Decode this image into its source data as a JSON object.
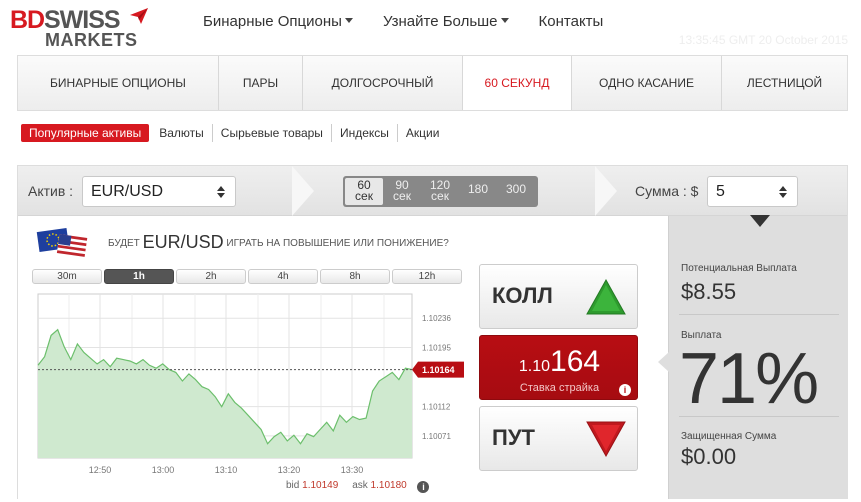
{
  "header": {
    "logo": {
      "bd": "BD",
      "swiss": "SWISS",
      "markets": "MARKETS"
    },
    "nav": [
      {
        "label": "Бинарные Опционы",
        "dropdown": true
      },
      {
        "label": "Узнайте Больше",
        "dropdown": true
      },
      {
        "label": "Контакты",
        "dropdown": false
      }
    ],
    "clock": "13:35:45 GMT 20 October 2015"
  },
  "tabs": [
    {
      "label": "БИНАРНЫЕ ОПЦИОНЫ",
      "active": false
    },
    {
      "label": "ПАРЫ",
      "active": false
    },
    {
      "label": "ДОЛГОСРОЧНЫЙ",
      "active": false
    },
    {
      "label": "60 СЕКУНД",
      "active": true
    },
    {
      "label": "ОДНО КАСАНИЕ",
      "active": false
    },
    {
      "label": "ЛЕСТНИЦОЙ",
      "active": false
    }
  ],
  "subnav": [
    {
      "label": "Популярные активы",
      "active": true
    },
    {
      "label": "Валюты",
      "active": false
    },
    {
      "label": "Сырьевые товары",
      "active": false
    },
    {
      "label": "Индексы",
      "active": false
    },
    {
      "label": "Акции",
      "active": false
    }
  ],
  "controls": {
    "asset_label": "Актив :",
    "asset_value": "EUR/USD",
    "expiry": [
      {
        "top": "60",
        "bottom": "сек",
        "active": true
      },
      {
        "top": "90",
        "bottom": "сек",
        "active": false
      },
      {
        "top": "120",
        "bottom": "сек",
        "active": false
      },
      {
        "top": "180",
        "bottom": "",
        "active": false
      },
      {
        "top": "300",
        "bottom": "",
        "active": false
      }
    ],
    "amount_label": "Сумма : $",
    "amount_value": "5"
  },
  "chart_header": {
    "prefix": "БУДЕТ",
    "pair": "EUR/USD",
    "suffix": "ИГРАТЬ НА ПОВЫШЕНИЕ ИЛИ ПОНИЖЕНИЕ?"
  },
  "ranges": [
    {
      "label": "30m",
      "active": false
    },
    {
      "label": "1h",
      "active": true
    },
    {
      "label": "2h",
      "active": false
    },
    {
      "label": "4h",
      "active": false
    },
    {
      "label": "8h",
      "active": false
    },
    {
      "label": "12h",
      "active": false
    }
  ],
  "chart_data": {
    "type": "area",
    "x_ticks": [
      "12:50",
      "13:00",
      "13:10",
      "13:20",
      "13:30"
    ],
    "y_ticks": [
      1.10236,
      1.10195,
      1.10112,
      1.10071
    ],
    "ylim": [
      1.1004,
      1.1027
    ],
    "current_price": "1.10164",
    "grid": true,
    "values": [
      1.1017,
      1.10182,
      1.10212,
      1.1022,
      1.10196,
      1.10178,
      1.102,
      1.10188,
      1.1018,
      1.10172,
      1.10178,
      1.10168,
      1.1018,
      1.10178,
      1.10176,
      1.10172,
      1.10178,
      1.1017,
      1.10166,
      1.10172,
      1.10164,
      1.1016,
      1.10148,
      1.10158,
      1.1015,
      1.1014,
      1.10136,
      1.10126,
      1.10112,
      1.1013,
      1.10118,
      1.1011,
      1.101,
      1.1009,
      1.1008,
      1.1006,
      1.1007,
      1.10076,
      1.10064,
      1.10072,
      1.1006,
      1.10074,
      1.1007,
      1.1008,
      1.1009,
      1.10078,
      1.101,
      1.1009,
      1.10098,
      1.10094,
      1.10096,
      1.10134,
      1.10148,
      1.10154,
      1.1016,
      1.1015,
      1.10166,
      1.10164
    ]
  },
  "quote": {
    "bid_label": "bid",
    "bid_value": "1.10149",
    "ask_label": "ask",
    "ask_value": "1.10180"
  },
  "buttons": {
    "call_label": "КОЛЛ",
    "put_label": "ПУТ",
    "strike_prefix": "1.10",
    "strike_big": "164",
    "strike_label": "Ставка страйка"
  },
  "payout": {
    "potential_label": "Потенциальная Выплата",
    "potential_value": "$8.55",
    "payout_label": "Выплата",
    "payout_value": "71%",
    "protected_label": "Защищенная Сумма",
    "protected_value": "$0.00"
  },
  "colors": {
    "brand_red": "#d71920",
    "call_green": "#2e9b2e",
    "put_red": "#d71920",
    "chart_fill": "#cfe9cf",
    "chart_line": "#6cbf6c"
  }
}
